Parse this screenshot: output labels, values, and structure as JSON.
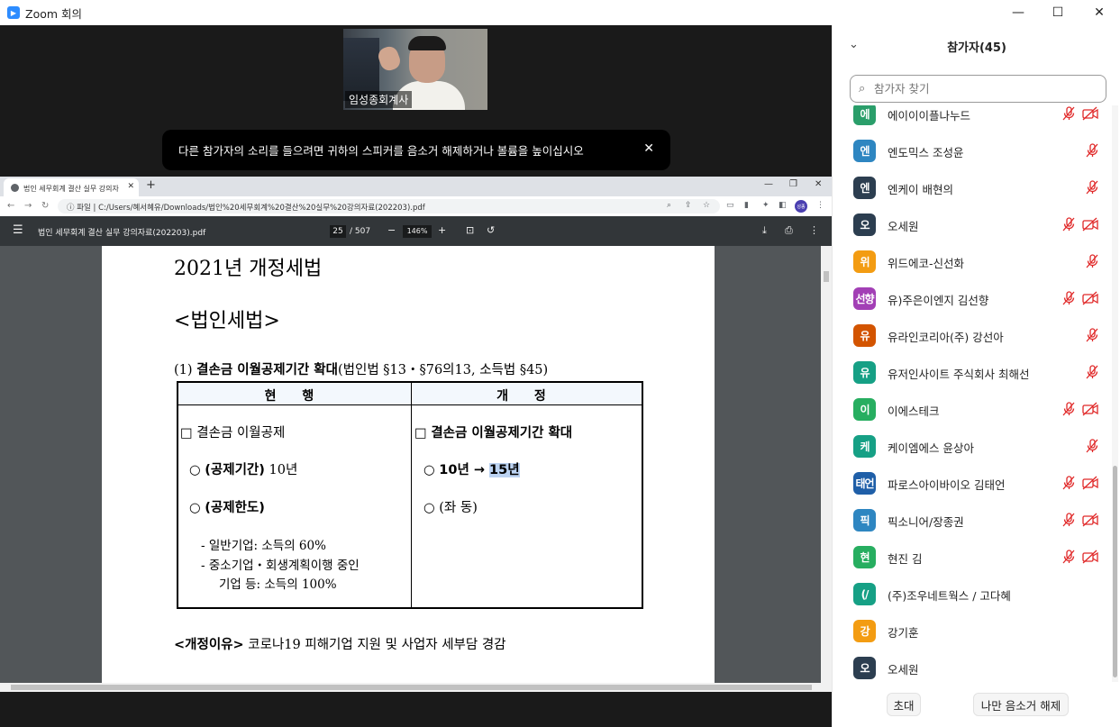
{
  "window": {
    "title": "Zoom 회의"
  },
  "meeting": {
    "video_name": "임성종회계사",
    "notice": "다른 참가자의 소리를 들으려면 귀하의 스피커를 음소거 해제하거나 볼륨을 높이십시오"
  },
  "browser": {
    "tab_title": "법인 세무회계 결산 실무 강의자",
    "address_prefix": "파일",
    "address": "C:/Users/혜서혜유/Downloads/법인%20세무회계%20결산%20실무%20강의자료(202203).pdf",
    "profile_initials": "성종"
  },
  "pdf": {
    "file_name": "법인 세무회계 결산 실무 강의자료(202203).pdf",
    "page_current": "25",
    "page_total": "/ 507",
    "zoom": "146%",
    "heading1": "2021년 개정세법",
    "heading2": "<법인세법>",
    "section_num": "(1) ",
    "section_bold": "결손금 이월공제기간 확대",
    "section_rest": "(법인법 §13・§76의13, 소득법 §45)",
    "col_current": "현 행",
    "col_revised": "개 정",
    "left": {
      "l1": "□ 결손금 이월공제",
      "l2_bullet": "○ ",
      "l2_bold": "(공제기간)",
      "l2_rest": " 10년",
      "l3_bullet": "○ ",
      "l3_bold": "(공제한도)",
      "l4": "- 일반기업: 소득의 60%",
      "l5": "- 중소기업・회생계획이행 중인",
      "l6": "기업 등: 소득의 100%"
    },
    "right": {
      "r1_box": "□ ",
      "r1_bold": "결손금 이월공제기간 확대",
      "r2_bullet": "○ ",
      "r2_bold": "10년 → ",
      "r2_hl": "15년",
      "r3": "○ (좌 동)"
    },
    "reason_bold": "<개정이유>",
    "reason_rest": " 코로나19 피해기업 지원 및 사업자 세부담 경감"
  },
  "panel": {
    "title": "참가자(45)",
    "search_placeholder": "참가자 찾기",
    "participants": [
      {
        "initial": "에",
        "name": "에이이이플나누드",
        "color": "#2a9e6a",
        "mic_muted": true,
        "cam_off": true
      },
      {
        "initial": "엔",
        "name": "엔도믹스 조성윤",
        "color": "#2e86c1",
        "mic_muted": true,
        "cam_off": false
      },
      {
        "initial": "엔",
        "name": "엔케이 배현의",
        "color": "#2c3e50",
        "mic_muted": true,
        "cam_off": false
      },
      {
        "initial": "오",
        "name": "오세원",
        "color": "#2c3e50",
        "mic_muted": true,
        "cam_off": true
      },
      {
        "initial": "위",
        "name": "위드에코-신선화",
        "color": "#f39c12",
        "mic_muted": true,
        "cam_off": false
      },
      {
        "initial": "선향",
        "name": "유)주은이엔지 김선향",
        "color": "#a23fb5",
        "mic_muted": true,
        "cam_off": true
      },
      {
        "initial": "유",
        "name": "유라인코리아(주) 강선아",
        "color": "#d35400",
        "mic_muted": true,
        "cam_off": false
      },
      {
        "initial": "유",
        "name": "유저인사이트 주식회사 최해선",
        "color": "#16a085",
        "mic_muted": true,
        "cam_off": false
      },
      {
        "initial": "이",
        "name": "이에스테크",
        "color": "#27ae60",
        "mic_muted": true,
        "cam_off": true
      },
      {
        "initial": "케",
        "name": "케이엠에스 윤상아",
        "color": "#16a085",
        "mic_muted": true,
        "cam_off": false
      },
      {
        "initial": "태언",
        "name": "파로스아이바이오 김태언",
        "color": "#1f5fa8",
        "mic_muted": true,
        "cam_off": true
      },
      {
        "initial": "픽",
        "name": "픽소니어/장종권",
        "color": "#2e86c1",
        "mic_muted": true,
        "cam_off": true
      },
      {
        "initial": "현",
        "name": "현진 김",
        "color": "#27ae60",
        "mic_muted": true,
        "cam_off": true
      },
      {
        "initial": "(/",
        "name": "(주)조우네트웍스 / 고다혜",
        "color": "#16a085",
        "mic_muted": false,
        "cam_off": false
      },
      {
        "initial": "강",
        "name": "강기훈",
        "color": "#f39c12",
        "mic_muted": false,
        "cam_off": false
      },
      {
        "initial": "오",
        "name": "오세원",
        "color": "#2c3e50",
        "mic_muted": false,
        "cam_off": false
      }
    ],
    "invite_label": "초대",
    "unmute_label": "나만 음소거 해제"
  }
}
